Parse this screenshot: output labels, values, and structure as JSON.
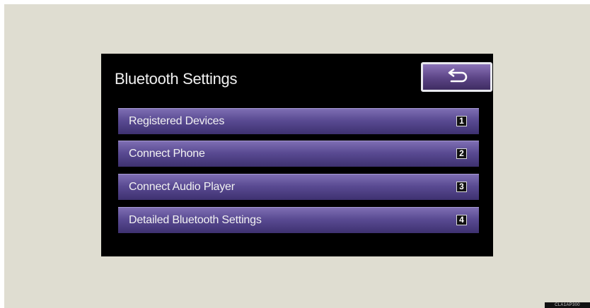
{
  "screen": {
    "title": "Bluetooth Settings",
    "back_icon": "return-arrow-icon",
    "menu": [
      {
        "label": "Registered Devices",
        "number": "1"
      },
      {
        "label": "Connect Phone",
        "number": "2"
      },
      {
        "label": "Connect Audio Player",
        "number": "3"
      },
      {
        "label": "Detailed Bluetooth Settings",
        "number": "4"
      }
    ]
  },
  "colors": {
    "page_background": "#dfddd1",
    "screen_background": "#000000",
    "button_purple": "#5a4b93"
  },
  "corner_tag": "CLA1AP300"
}
